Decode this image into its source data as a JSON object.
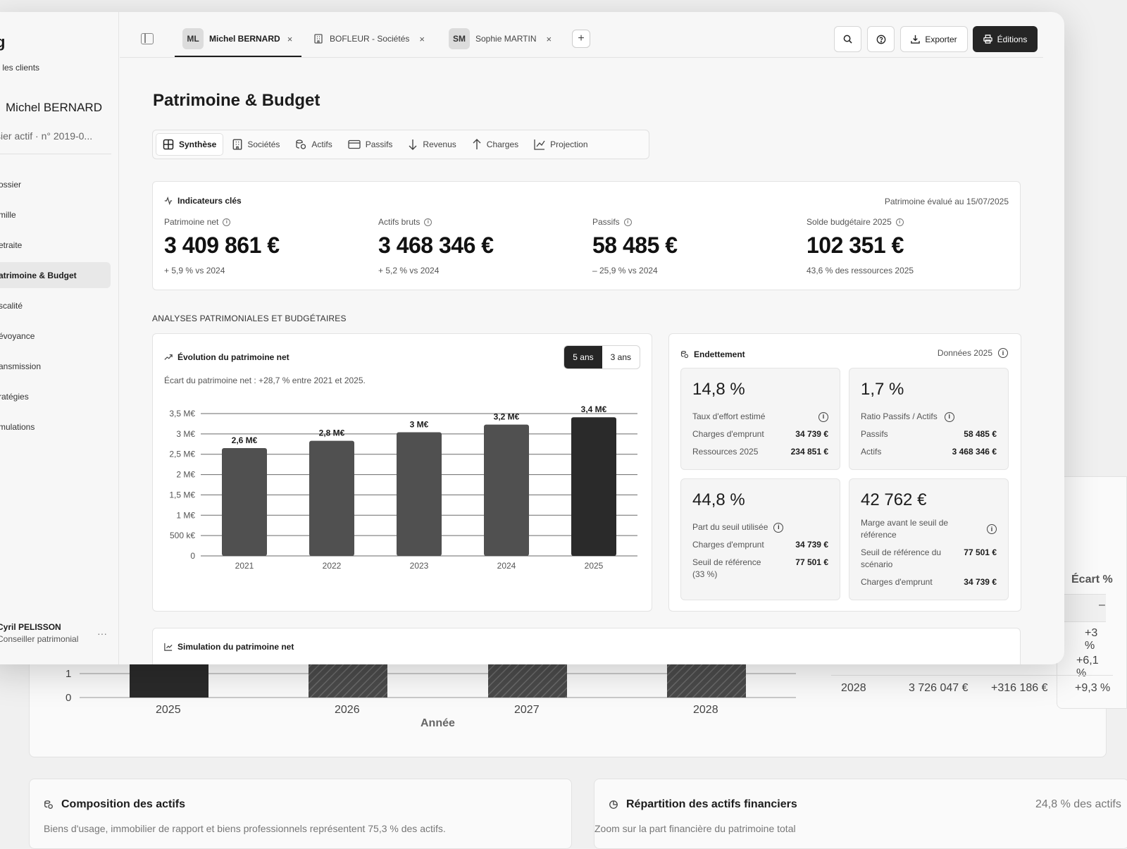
{
  "background": {
    "sim_chart": {
      "y_ticks": [
        "1",
        "0"
      ],
      "x_ticks": [
        "2025",
        "2026",
        "2027",
        "2028"
      ],
      "xlabel": "Année"
    },
    "sim_table": {
      "header_ecart": "Écart %",
      "dash": "–",
      "rows": [
        {
          "ecart_pct": "+3 %"
        },
        {
          "ecart_pct": "+6,1 %"
        },
        {
          "year": "2028",
          "value": "3 726 047 €",
          "ecart": "+316 186 €",
          "ecart_pct": "+9,3 %"
        }
      ]
    },
    "composition": {
      "title": "Composition des actifs",
      "subtitle": "Biens d'usage, immobilier de rapport et biens professionnels représentent 75,3 % des actifs."
    },
    "repartition": {
      "title": "Répartition des actifs financiers",
      "subtitle": "Zoom sur la part financière du patrimoine total",
      "badge": "24,8 % des actifs"
    }
  },
  "sidebar": {
    "brand": "g",
    "back": "s les clients",
    "client": "Michel BERNARD",
    "meta": "sier actif · n° 2019-0...",
    "items": [
      {
        "label": "ossier"
      },
      {
        "label": "mille"
      },
      {
        "label": "etraite"
      },
      {
        "label": "atrimoine & Budget",
        "active": true
      },
      {
        "label": "scalité"
      },
      {
        "label": "évoyance"
      },
      {
        "label": "ansmission"
      },
      {
        "label": "ratégies"
      },
      {
        "label": "mulations"
      }
    ],
    "user": {
      "name": "Cyril PELISSON",
      "role": "Conseiller patrimonial",
      "more": "···"
    }
  },
  "tabs": [
    {
      "initials": "ML",
      "label": "Michel BERNARD",
      "active": true
    },
    {
      "icon": "building-icon",
      "label": "BOFLEUR - Sociétés"
    },
    {
      "initials": "SM",
      "label": "Sophie MARTIN"
    }
  ],
  "toolbar": {
    "export": "Exporter",
    "editions": "Éditions",
    "add": "+",
    "close": "×"
  },
  "page": {
    "title": "Patrimoine & Budget"
  },
  "subtabs": [
    {
      "label": "Synthèse",
      "icon": "grid-icon",
      "active": true
    },
    {
      "label": "Sociétés",
      "icon": "building-icon"
    },
    {
      "label": "Actifs",
      "icon": "coins-icon"
    },
    {
      "label": "Passifs",
      "icon": "card-icon"
    },
    {
      "label": "Revenus",
      "icon": "arrow-down-icon"
    },
    {
      "label": "Charges",
      "icon": "arrow-up-icon"
    },
    {
      "label": "Projection",
      "icon": "line-chart-icon"
    }
  ],
  "indicators": {
    "title": "Indicateurs clés",
    "date_note": "Patrimoine évalué au 15/07/2025",
    "kpis": [
      {
        "label": "Patrimoine net",
        "value": "3 409 861 €",
        "sub": "+ 5,9 % vs 2024"
      },
      {
        "label": "Actifs bruts",
        "value": "3 468 346 €",
        "sub": "+ 5,2 % vs 2024"
      },
      {
        "label": "Passifs",
        "value": "58 485 €",
        "sub": "– 25,9 % vs 2024"
      },
      {
        "label": "Solde budgétaire 2025",
        "value": "102 351 €",
        "sub": "43,6 % des ressources 2025"
      }
    ]
  },
  "section": {
    "label": "ANALYSES PATRIMONIALES ET BUDGÉTAIRES"
  },
  "evolution": {
    "title": "Évolution du patrimoine net",
    "seg": [
      "5 ans",
      "3 ans"
    ],
    "note": "Écart du patrimoine net : +28,7 % entre 2021 et 2025."
  },
  "chart_data": {
    "type": "bar",
    "categories": [
      "2021",
      "2022",
      "2023",
      "2024",
      "2025"
    ],
    "values": [
      2.65,
      2.83,
      3.04,
      3.23,
      3.41
    ],
    "data_labels": [
      "2,6 M€",
      "2,8 M€",
      "3 M€",
      "3,2 M€",
      "3,4 M€"
    ],
    "y_ticks": [
      {
        "v": 3.5,
        "label": "3,5 M€"
      },
      {
        "v": 3.0,
        "label": "3 M€"
      },
      {
        "v": 2.5,
        "label": "2,5 M€"
      },
      {
        "v": 2.0,
        "label": "2 M€"
      },
      {
        "v": 1.5,
        "label": "1,5 M€"
      },
      {
        "v": 1.0,
        "label": "1 M€"
      },
      {
        "v": 0.5,
        "label": "500 k€"
      },
      {
        "v": 0.0,
        "label": "0"
      }
    ],
    "ylim": [
      0,
      3.5
    ],
    "grid": true,
    "colors": {
      "default": "#505050",
      "highlight": "#2a2a2a"
    }
  },
  "debt": {
    "title": "Endettement",
    "note": "Données 2025",
    "boxes": [
      {
        "value": "14,8 %",
        "label": "Taux d'effort estimé",
        "rows": [
          [
            "Charges d'emprunt",
            "34 739 €"
          ],
          [
            "Ressources 2025",
            "234 851 €"
          ]
        ]
      },
      {
        "value": "1,7 %",
        "label": "Ratio Passifs / Actifs",
        "rows": [
          [
            "Passifs",
            "58 485 €"
          ],
          [
            "Actifs",
            "3 468 346 €"
          ]
        ]
      },
      {
        "value": "44,8 %",
        "label": "Part du seuil utilisée",
        "rows": [
          [
            "Charges d'emprunt",
            "34 739 €"
          ],
          [
            "Seuil de référence (33 %)",
            "77 501 €"
          ]
        ]
      },
      {
        "value": "42 762 €",
        "label": "Marge avant le seuil de référence",
        "rows": [
          [
            "Seuil de référence du scénario",
            "77 501 €"
          ],
          [
            "Charges d'emprunt",
            "34 739 €"
          ]
        ]
      }
    ]
  },
  "simulation": {
    "title": "Simulation du patrimoine net"
  }
}
